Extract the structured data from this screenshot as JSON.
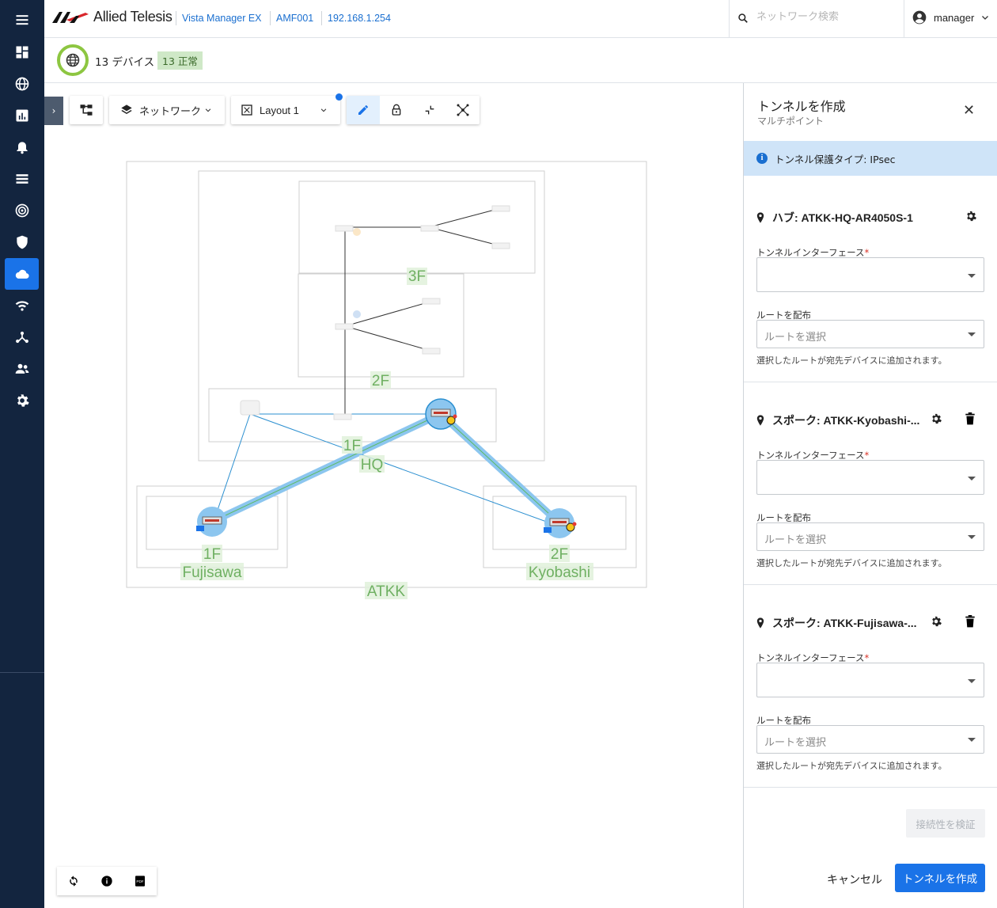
{
  "brand": {
    "logo_text": "Allied Telesis"
  },
  "breadcrumb": [
    "Vista Manager EX",
    "AMF001",
    "192.168.1.254"
  ],
  "search": {
    "placeholder": "ネットワーク検索"
  },
  "user": {
    "name": "manager"
  },
  "status": {
    "device_count": "13 デバイス",
    "ok_badge": "13 正常"
  },
  "rail": {
    "icons": [
      "menu-icon",
      "dashboard-icon",
      "globe-icon",
      "chart-icon",
      "alarm-icon",
      "list-icon",
      "radar-icon",
      "shield-icon",
      "cloud-icon",
      "wifi-icon",
      "topology-icon",
      "users-icon",
      "settings-icon"
    ],
    "active": "cloud-icon"
  },
  "toolbar": {
    "network_label": "ネットワーク",
    "layout_label": "Layout 1"
  },
  "map": {
    "zone_labels": [
      "3F",
      "2F",
      "1F",
      "HQ",
      "1F",
      "Fujisawa",
      "2F",
      "Kyobashi",
      "ATKK"
    ]
  },
  "panel": {
    "title": "トンネルを作成",
    "subtitle": "マルチポイント",
    "info": "トンネル保護タイプ: IPsec",
    "sections": [
      {
        "title": "ハブ: ATKK-HQ-AR4050S-1",
        "iface_label": "トンネルインターフェース",
        "iface_value": "",
        "route_label": "ルートを配布",
        "route_placeholder": "ルートを選択",
        "helper": "選択したルートが宛先デバイスに追加されます。"
      },
      {
        "title": "スポーク: ATKK-Kyobashi-...",
        "iface_label": "トンネルインターフェース",
        "iface_value": "",
        "route_label": "ルートを配布",
        "route_placeholder": "ルートを選択",
        "helper": "選択したルートが宛先デバイスに追加されます。"
      },
      {
        "title": "スポーク: ATKK-Fujisawa-...",
        "iface_label": "トンネルインターフェース",
        "iface_value": "",
        "route_label": "ルートを配布",
        "route_placeholder": "ルートを選択",
        "helper": "選択したルートが宛先デバイスに追加されます。"
      }
    ],
    "verify_label": "接続性を検証",
    "cancel_label": "キャンセル",
    "create_label": "トンネルを作成"
  },
  "colors": {
    "rail_bg": "#13253f",
    "accent": "#1a73e8",
    "ok_green": "#8dc641",
    "tunnel": "#8cc6ef"
  }
}
